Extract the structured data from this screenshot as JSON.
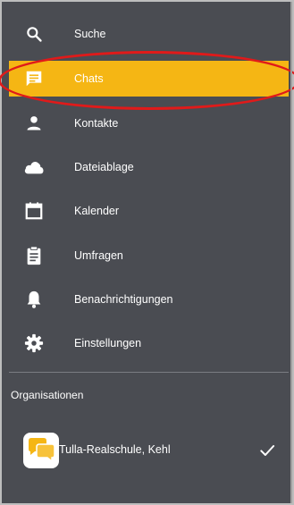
{
  "nav": {
    "items": [
      {
        "label": "Suche",
        "icon": "search-icon",
        "active": false
      },
      {
        "label": "Chats",
        "icon": "chat-icon",
        "active": true
      },
      {
        "label": "Kontakte",
        "icon": "person-icon",
        "active": false
      },
      {
        "label": "Dateiablage",
        "icon": "cloud-icon",
        "active": false
      },
      {
        "label": "Kalender",
        "icon": "calendar-icon",
        "active": false
      },
      {
        "label": "Umfragen",
        "icon": "clipboard-icon",
        "active": false
      },
      {
        "label": "Benachrichtigungen",
        "icon": "bell-icon",
        "active": false
      },
      {
        "label": "Einstellungen",
        "icon": "gear-icon",
        "active": false
      }
    ]
  },
  "organisations": {
    "title": "Organisationen",
    "items": [
      {
        "name": "Tulla-Realschule, Kehl",
        "selected": true,
        "icon": "org-logo-icon"
      }
    ]
  },
  "colors": {
    "drawer_bg": "#4a4c52",
    "active_bg": "#f5b614",
    "text": "#ffffff",
    "annotation_ring": "#e01a1a"
  }
}
